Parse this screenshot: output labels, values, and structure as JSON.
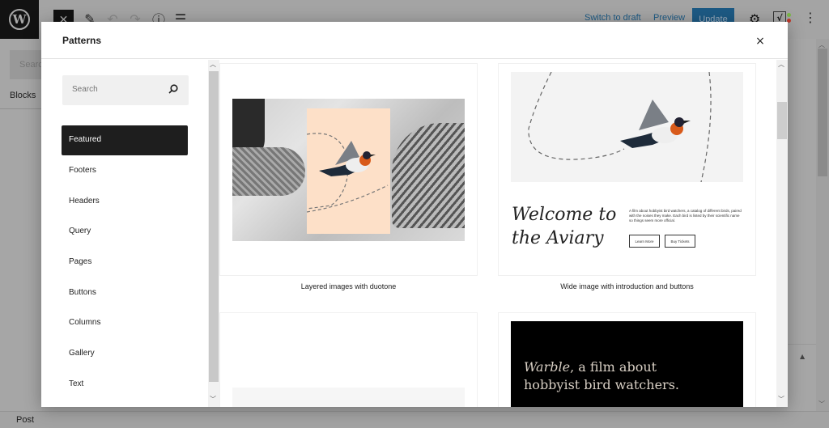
{
  "editor": {
    "toolbar": {
      "close_icon": "close-icon",
      "switch_to_draft": "Switch to draft",
      "preview": "Preview",
      "update": "Update",
      "icons": [
        "pencil-icon",
        "undo-icon",
        "redo-icon",
        "info-icon",
        "list-view-icon",
        "gear-icon",
        "yoast-icon",
        "more-vertical-icon"
      ]
    },
    "left_panel": {
      "search_placeholder": "Searc",
      "tab_label": "Blocks"
    },
    "footer": {
      "breadcrumb": "Post"
    }
  },
  "modal": {
    "title": "Patterns",
    "close_label": "×",
    "search": {
      "placeholder": "Search"
    },
    "categories": [
      {
        "label": "Featured",
        "active": true
      },
      {
        "label": "Footers",
        "active": false
      },
      {
        "label": "Headers",
        "active": false
      },
      {
        "label": "Query",
        "active": false
      },
      {
        "label": "Pages",
        "active": false
      },
      {
        "label": "Buttons",
        "active": false
      },
      {
        "label": "Columns",
        "active": false
      },
      {
        "label": "Gallery",
        "active": false
      },
      {
        "label": "Text",
        "active": false
      }
    ],
    "patterns": [
      {
        "label": "Layered images with duotone",
        "colors": {
          "peach": "#fde0c8"
        }
      },
      {
        "label": "Wide image with introduction and buttons",
        "heading_line1": "Welcome to",
        "heading_line2": "the Aviary",
        "description": "A film about hobbyist bird watchers, a catalog of different birds, paired with the noises they make. Each bird is listed by their scientific name so things seem more official.",
        "button1": "Learn More",
        "button2": "Buy Tickets"
      },
      {
        "label": ""
      },
      {
        "label": "",
        "title_em": "Warble",
        "title_rest": ", a film about",
        "title_line2": "hobbyist bird watchers."
      }
    ]
  },
  "colors": {
    "accent": "#1e1e1e",
    "update_button": "#1d5a84",
    "overlay": "#a3a3a3"
  }
}
